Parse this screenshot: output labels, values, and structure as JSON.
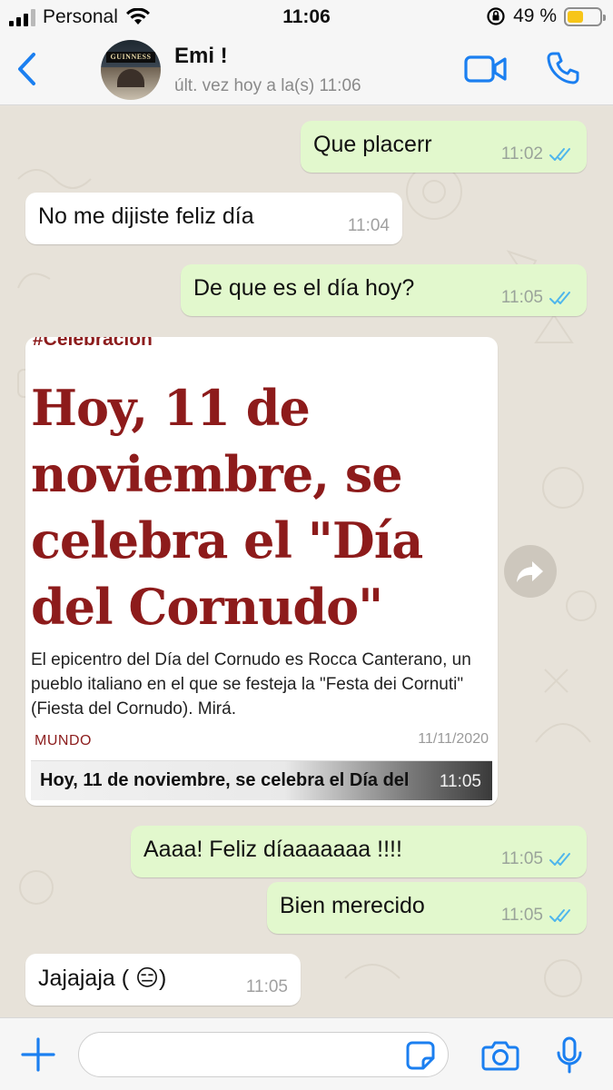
{
  "status_bar": {
    "carrier": "Personal",
    "time": "11:06",
    "battery_percent": "49 %",
    "battery_level": 0.49
  },
  "header": {
    "contact_name": "Emi !",
    "last_seen": "últ. vez hoy a la(s) 11:06",
    "avatar_sign_text": "GUINNESS"
  },
  "messages": [
    {
      "direction": "out",
      "text": "Que placerr",
      "time": "11:02",
      "status": "read"
    },
    {
      "direction": "in",
      "text": "No me dijiste feliz día",
      "time": "11:04"
    },
    {
      "direction": "out",
      "text": "De que es el día hoy?",
      "time": "11:05",
      "status": "read"
    },
    {
      "direction": "out",
      "text": "Aaaa! Feliz díaaaaaaa !!!!",
      "time": "11:05",
      "status": "read"
    },
    {
      "direction": "out",
      "text": "Bien merecido",
      "time": "11:05",
      "status": "read"
    },
    {
      "direction": "in",
      "text": "Jajajaja ( 😑)",
      "time": "11:05"
    }
  ],
  "link_card": {
    "tag": "#Celebración",
    "headline": "Hoy, 11 de noviembre, se celebra el \"Día del Cornudo\"",
    "description": "El epicentro del Día del Cornudo es Rocca Canterano, un pueblo italiano en el que se festeja la \"Festa dei Cornuti\" (Fiesta del Cornudo). Mirá.",
    "category": "MUNDO",
    "date": "11/11/2020",
    "link_title": "Hoy, 11 de noviembre, se celebra el Día del",
    "time": "11:05"
  },
  "input": {
    "placeholder": "",
    "value": ""
  },
  "icons": {
    "back": "chevron-left-icon",
    "video": "video-camera-icon",
    "phone": "phone-icon",
    "forward": "forward-arrow-icon",
    "plus": "plus-icon",
    "sticker": "sticker-icon",
    "camera": "camera-icon",
    "mic": "microphone-icon"
  },
  "colors": {
    "accent": "#1b7ff0",
    "outgoing_bubble": "#e2f8cd",
    "incoming_bubble": "#ffffff",
    "read_ticks": "#4fb6ec",
    "headline": "#8d1b1b",
    "battery": "#f7c518"
  }
}
